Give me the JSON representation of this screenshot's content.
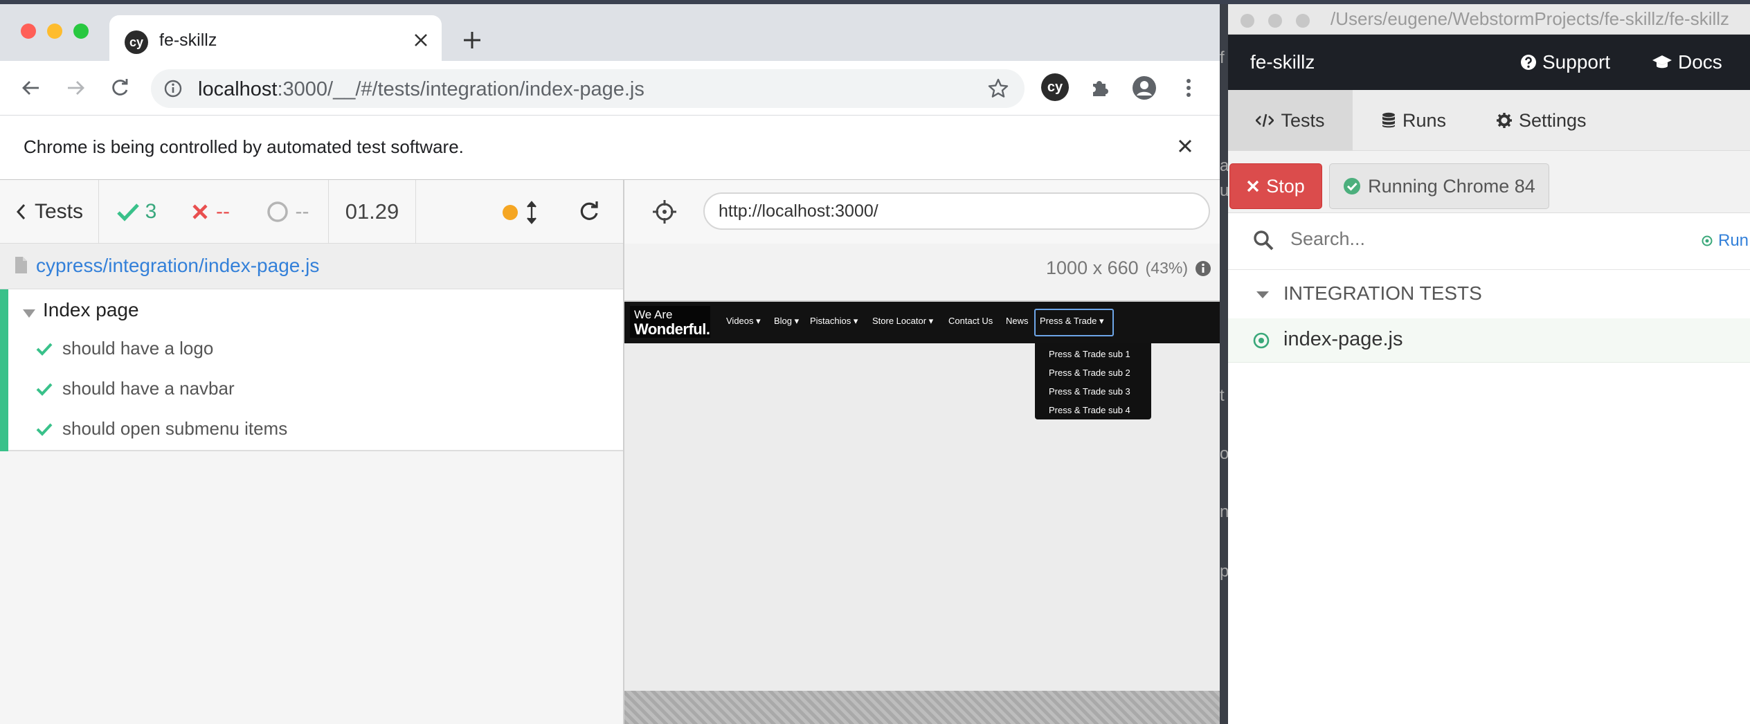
{
  "chrome": {
    "tab_title": "fe-skillz",
    "cy_logo": "cy",
    "url_host": "localhost",
    "url_rest": ":3000/__/#/tests/integration/index-page.js",
    "infobar_text": "Chrome is being controlled by automated test software.",
    "extension_label": "cy",
    "icons": [
      "back-arrow-icon",
      "forward-arrow-icon",
      "reload-icon",
      "info-icon",
      "star-icon",
      "puzzle-icon",
      "account-icon",
      "kebab-menu-icon",
      "close-icon",
      "plus-icon"
    ]
  },
  "runner": {
    "back_label": "Tests",
    "passed": "3",
    "failed": "--",
    "pending": "--",
    "duration": "01.29",
    "spec_path": "cypress/integration/index-page.js",
    "suite": "Index page",
    "tests": [
      "should have a logo",
      "should have a navbar",
      "should open submenu items"
    ],
    "colors": {
      "pass": "#39c18a",
      "fail": "#e94f4f",
      "link": "#3380d9",
      "indicator": "#f5a623"
    }
  },
  "aut": {
    "url": "http://localhost:3000/",
    "viewport": "1000 x 660",
    "scale": "(43%)",
    "site": {
      "logo_line1": "We Are",
      "logo_line2": "Wonderful.",
      "nav": [
        "Videos",
        "Blog",
        "Pistachios",
        "Store Locator",
        "Contact Us",
        "News",
        "Press & Trade"
      ],
      "dropdown": [
        "Press & Trade sub 1",
        "Press & Trade sub 2",
        "Press & Trade sub 3",
        "Press & Trade sub 4"
      ]
    }
  },
  "desktop": {
    "window_path": "/Users/eugene/WebstormProjects/fe-skillz/fe-skillz",
    "app_name": "fe-skillz",
    "support": "Support",
    "docs": "Docs",
    "tabs": [
      "Tests",
      "Runs",
      "Settings"
    ],
    "stop": "Stop",
    "running": "Running Chrome 84",
    "search_placeholder": "Search...",
    "run_all": "Run",
    "group": "INTEGRATION TESTS",
    "spec": "index-page.js",
    "background_glyphs": [
      "f",
      "a",
      "u",
      "t",
      "o",
      "n",
      "p"
    ]
  }
}
